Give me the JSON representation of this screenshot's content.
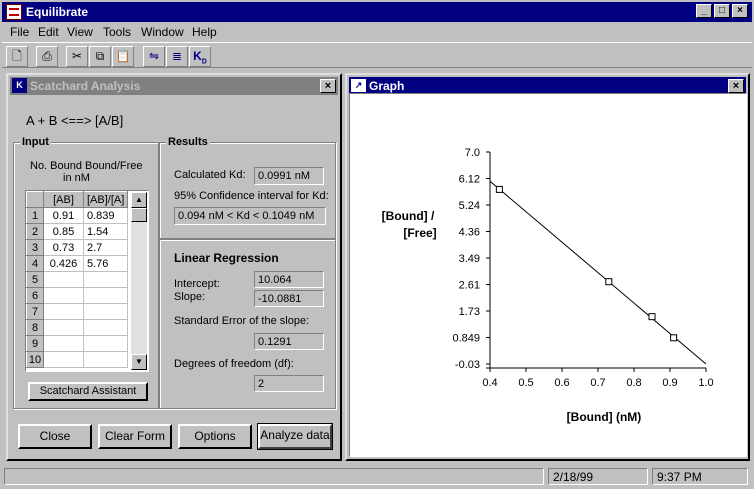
{
  "app": {
    "title": "Equilibrate"
  },
  "menu": [
    "File",
    "Edit",
    "View",
    "Tools",
    "Window",
    "Help"
  ],
  "toolbar": {
    "kd_label": "K",
    "kd_sub": "D"
  },
  "scatchard": {
    "title": "Scatchard Analysis",
    "equation": "A + B <==> [A/B]",
    "input": {
      "label": "Input",
      "header_line1": "No. Bound Bound/Free",
      "header_line2": "in nM",
      "col1": "[AB]",
      "col2": "[AB]/[A]",
      "rows": [
        {
          "n": "1",
          "ab": "0.91",
          "ratio": "0.839"
        },
        {
          "n": "2",
          "ab": "0.85",
          "ratio": "1.54"
        },
        {
          "n": "3",
          "ab": "0.73",
          "ratio": "2.7"
        },
        {
          "n": "4",
          "ab": "0.426",
          "ratio": "5.76"
        },
        {
          "n": "5",
          "ab": "",
          "ratio": ""
        },
        {
          "n": "6",
          "ab": "",
          "ratio": ""
        },
        {
          "n": "7",
          "ab": "",
          "ratio": ""
        },
        {
          "n": "8",
          "ab": "",
          "ratio": ""
        },
        {
          "n": "9",
          "ab": "",
          "ratio": ""
        },
        {
          "n": "10",
          "ab": "",
          "ratio": ""
        }
      ],
      "assistant_button": "Scatchard Assistant"
    },
    "results": {
      "label": "Results",
      "kd_label": "Calculated  Kd:",
      "kd_value": "0.0991 nM",
      "ci_label": "95% Confidence interval for Kd:",
      "ci_value": "0.094 nM < Kd < 0.1049 nM"
    },
    "regression": {
      "label": "Linear Regression",
      "intercept_label": "Intercept:",
      "intercept_value": "10.064",
      "slope_label": "Slope:",
      "slope_value": "-10.0881",
      "se_label": "Standard Error of the slope:",
      "se_value": "0.1291",
      "df_label": "Degrees of freedom (df):",
      "df_value": "2"
    },
    "buttons": {
      "close": "Close",
      "clear": "Clear Form",
      "options": "Options",
      "analyze": "Analyze data"
    }
  },
  "graph": {
    "title": "Graph"
  },
  "chart_data": {
    "type": "scatter",
    "xlabel": "[Bound] (nM)",
    "ylabel_line1": "[Bound] /",
    "ylabel_line2": "[Free]",
    "xlim": [
      0.4,
      1.0
    ],
    "ylim": [
      -0.03,
      7.0
    ],
    "x_ticks": [
      "0.4",
      "0.5",
      "0.6",
      "0.7",
      "0.8",
      "0.9",
      "1.0"
    ],
    "y_ticks": [
      "7.0",
      "6.12",
      "5.24",
      "4.36",
      "3.49",
      "2.61",
      "1.73",
      "0.849",
      "-0.03"
    ],
    "points": [
      {
        "x": 0.426,
        "y": 5.76
      },
      {
        "x": 0.73,
        "y": 2.7
      },
      {
        "x": 0.85,
        "y": 1.54
      },
      {
        "x": 0.91,
        "y": 0.839
      }
    ],
    "fit_line": {
      "x": [
        0.4,
        1.0
      ],
      "y": [
        6.03,
        -0.03
      ]
    }
  },
  "status": {
    "date": "2/18/99",
    "time": "9:37 PM"
  }
}
